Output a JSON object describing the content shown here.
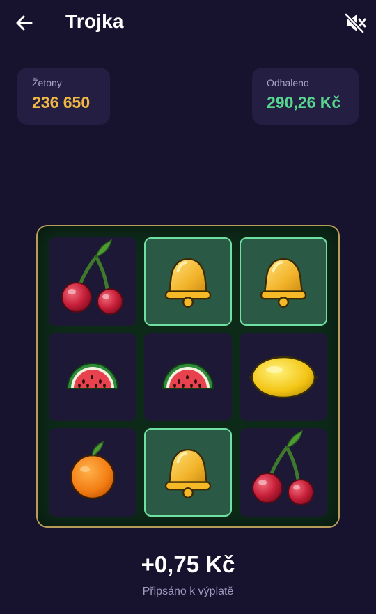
{
  "header": {
    "title": "Trojka",
    "back_icon": "arrow-left-icon",
    "mute_icon": "volume-off-icon"
  },
  "stats": {
    "tokens_label": "Žetony",
    "tokens_value": "236 650",
    "revealed_label": "Odhaleno",
    "revealed_value": "290,26 Kč"
  },
  "board": {
    "cells": [
      {
        "symbol": "cherry",
        "matched": false
      },
      {
        "symbol": "bell",
        "matched": true
      },
      {
        "symbol": "bell",
        "matched": true
      },
      {
        "symbol": "watermelon",
        "matched": false
      },
      {
        "symbol": "watermelon",
        "matched": false
      },
      {
        "symbol": "lemon",
        "matched": false
      },
      {
        "symbol": "orange",
        "matched": false
      },
      {
        "symbol": "bell",
        "matched": true
      },
      {
        "symbol": "cherry",
        "matched": false
      }
    ]
  },
  "result": {
    "amount": "+0,75 Kč",
    "caption": "Připsáno k výplatě"
  },
  "colors": {
    "background": "#17132e",
    "tokens": "#f2b843",
    "revealed": "#57d68f",
    "match_border": "#6fe0a2",
    "board_border": "#b79b58"
  }
}
